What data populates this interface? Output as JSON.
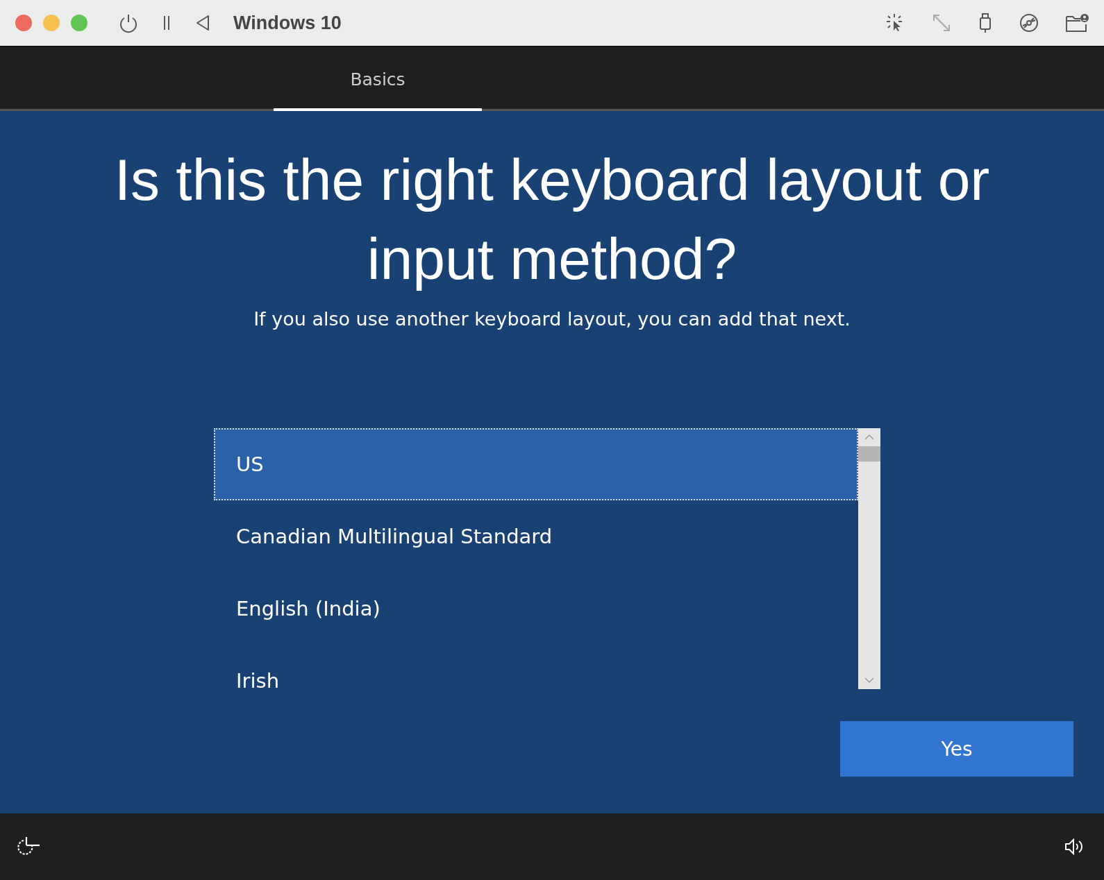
{
  "window": {
    "title": "Windows 10"
  },
  "tabs": [
    {
      "label": "Basics",
      "selected": true
    }
  ],
  "heading": "Is this the right keyboard layout or input method?",
  "subtitle": "If you also use another keyboard layout, you can add that next.",
  "layouts": [
    {
      "label": "US",
      "selected": true
    },
    {
      "label": "Canadian Multilingual Standard",
      "selected": false
    },
    {
      "label": "English (India)",
      "selected": false
    },
    {
      "label": "Irish",
      "selected": false
    }
  ],
  "buttons": [
    "Yes"
  ]
}
